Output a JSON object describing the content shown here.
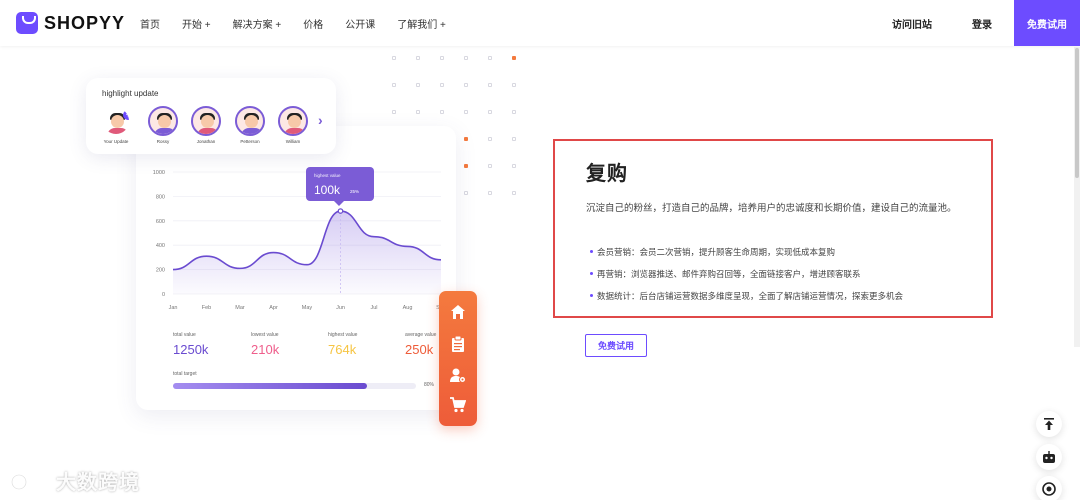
{
  "nav": {
    "logo_text": "SHOPYY",
    "links": [
      "首页",
      "开始 +",
      "解决方案 +",
      "价格",
      "公开课",
      "了解我们 +"
    ],
    "visit_old": "访问旧站",
    "login": "登录",
    "free_trial": "免费试用"
  },
  "highlight": {
    "title": "highlight update",
    "avatars": [
      "Your Update",
      "Rossy",
      "Jonathan",
      "Petterson",
      "William"
    ]
  },
  "chart_data": {
    "type": "area",
    "x": [
      "Jan",
      "Feb",
      "Mar",
      "Apr",
      "May",
      "Jun",
      "Jul",
      "Aug",
      "Sep"
    ],
    "series": [
      {
        "values": [
          200,
          310,
          210,
          340,
          240,
          680,
          470,
          390,
          280
        ]
      }
    ],
    "yticks": [
      0,
      200,
      400,
      600,
      800,
      1000
    ],
    "ylim": [
      0,
      1000
    ],
    "title": "",
    "xlabel": "",
    "ylabel": "",
    "grid": true,
    "tooltip": {
      "label": "highest value",
      "value": "100k",
      "pct": "25%"
    }
  },
  "stats": [
    {
      "label": "total value",
      "value": "1250k",
      "color": "#6a4bd0"
    },
    {
      "label": "lowest value",
      "value": "210k",
      "color": "#ef5e8c"
    },
    {
      "label": "highest value",
      "value": "764k",
      "color": "#f6c543"
    },
    {
      "label": "average value",
      "value": "250k",
      "color": "#ee5c39"
    }
  ],
  "target": {
    "label": "total target",
    "percent": 80,
    "percent_label": "80%"
  },
  "side_menu_icons": [
    "home-icon",
    "clipboard-icon",
    "user-gear-icon",
    "cart-icon"
  ],
  "section": {
    "title": "复购",
    "description": "沉淀自己的粉丝，打造自己的品牌，培养用户的忠诚度和长期价值，建设自己的流量池。",
    "bullets": [
      "会员营销：会员二次营销，提升顾客生命周期，实现低成本复购",
      "再营销：浏览器推送、邮件弃购召回等，全面链接客户，增进顾客联系",
      "数据统计：后台店铺运营数据多维度呈现，全面了解店铺运营情况，探索更多机会"
    ],
    "button": "免费试用"
  },
  "float_buttons": [
    "back-to-top-icon",
    "chatbot-icon",
    "support-icon"
  ],
  "watermark": "大数跨境",
  "colors": {
    "brand": "#6d4cff",
    "accent_orange": "#ee5c39",
    "highlight_border": "#e04848"
  }
}
